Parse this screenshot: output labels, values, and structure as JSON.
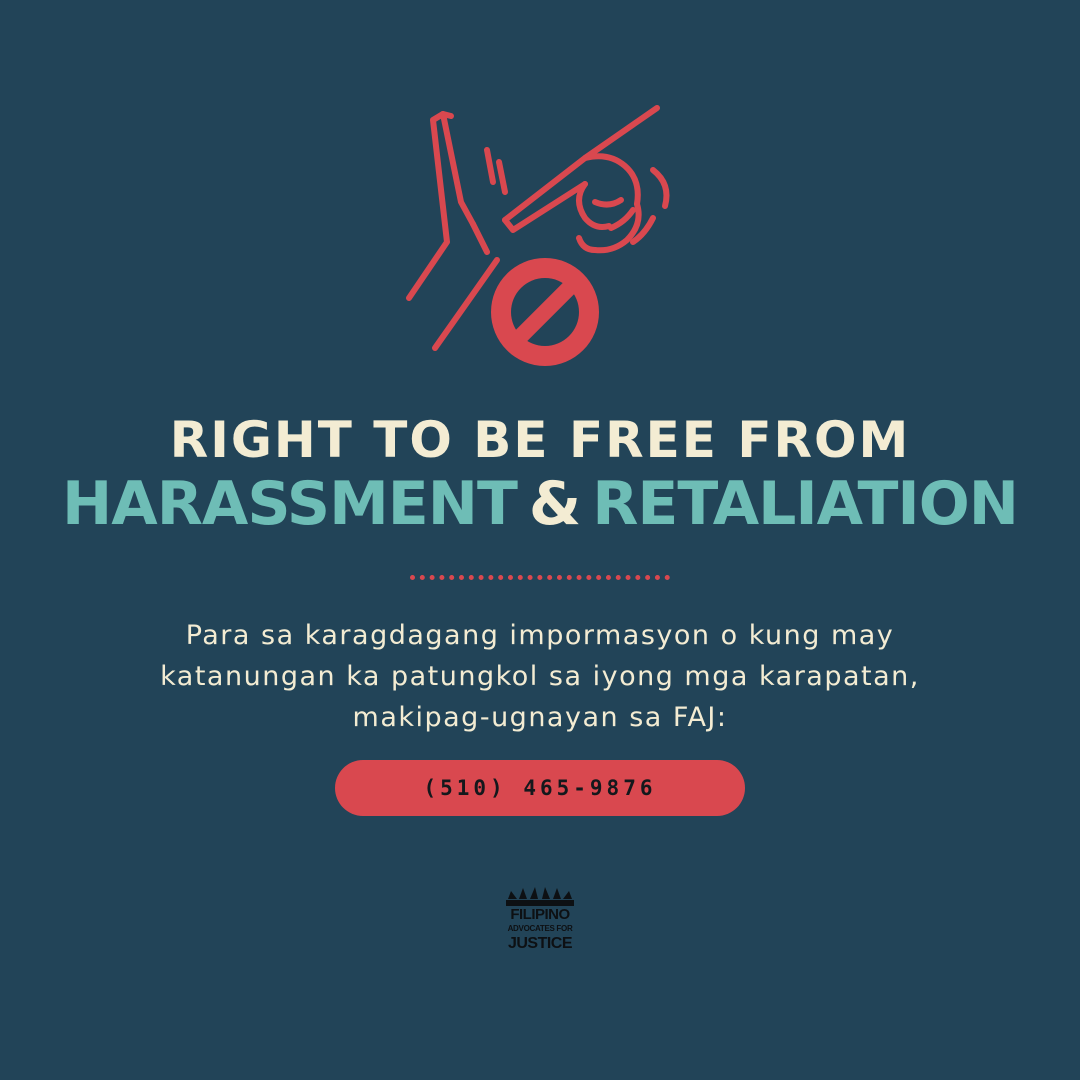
{
  "hero": {
    "icon": "hand-stop-harassment-icon",
    "color": "#d9484f"
  },
  "title": {
    "line1": "RIGHT TO BE FREE FROM",
    "word_harassment": "HARASSMENT",
    "ampersand": "&",
    "word_retaliation": "RETALIATION"
  },
  "body": {
    "line1": "Para sa karagdagang impormasyon o kung may",
    "line2": "katanungan ka patungkol sa iyong mga karapatan,",
    "line3": "makipag-ugnayan sa FAJ:"
  },
  "contact": {
    "phone": "(510) 465-9876"
  },
  "logo": {
    "line1": "FILIPINO",
    "line2": "ADVOCATES FOR",
    "line3": "JUSTICE"
  },
  "colors": {
    "background": "#224458",
    "accent_red": "#d9484f",
    "teal": "#6ebdb6",
    "cream": "#f3ecd3"
  }
}
